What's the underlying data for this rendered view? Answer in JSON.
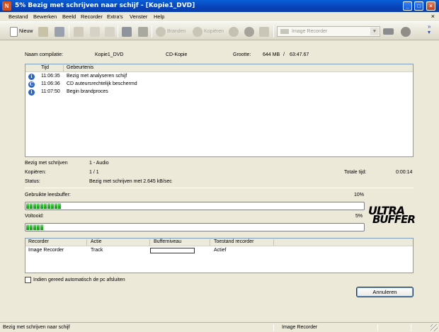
{
  "window": {
    "title": "5% Bezig met schrijven naar schijf - [Kopie1_DVD]",
    "buttons": [
      "minimize",
      "maximize",
      "close"
    ]
  },
  "menu": [
    "Bestand",
    "Bewerken",
    "Beeld",
    "Recorder",
    "Extra's",
    "Venster",
    "Help"
  ],
  "toolbar": {
    "new_label": "Nieuw",
    "branden_label": "Branden",
    "kopieren_label": "Kopiëren",
    "recorder_select": "Image Recorder"
  },
  "summary": {
    "name_label": "Naam compilatie:",
    "name_value": "Kopie1_DVD",
    "type_value": "CD-Kopie",
    "size_label": "Grootte:",
    "size_value": "644 MB",
    "size_sep": "/",
    "duration_value": "63:47.67"
  },
  "log": {
    "columns": [
      "Tijd",
      "Gebeurtenis"
    ],
    "rows": [
      {
        "icon": "info-icon",
        "time": "11:06:35",
        "message": "Bezig met analyseren schijf"
      },
      {
        "icon": "copyright-icon",
        "time": "11:06:36",
        "message": "CD auteursrechtelijk beschermd"
      },
      {
        "icon": "info-icon",
        "time": "11:07:50",
        "message": "Begin brandproces"
      }
    ]
  },
  "progress_info": {
    "writing_label": "Bezig met schrijven",
    "writing_value": "1 - Audio",
    "copies_label": "Kopiëren:",
    "copies_value": "1 / 1",
    "total_time_label": "Totale tijd:",
    "total_time_value": "0:00:14",
    "status_label": "Status:",
    "status_value": "Bezig met schrijven met 2.645 kB/sec"
  },
  "buffer": {
    "label": "Gebruikte leesbuffer:",
    "percent_text": "10%",
    "fraction": 0.1
  },
  "done": {
    "label": "Voltooid:",
    "percent_text": "5%",
    "fraction": 0.05
  },
  "logo": {
    "line1": "ULTRA",
    "line2": "BUFFER"
  },
  "recorders": {
    "columns": [
      "Recorder",
      "Actie",
      "Bufferniveau",
      "Toestand recorder"
    ],
    "rows": [
      {
        "recorder": "Image Recorder",
        "action": "Track",
        "buffer_fraction": 0,
        "state": "Actief"
      }
    ]
  },
  "shutdown_checkbox": {
    "label": "Indien gereed automatisch de pc afsluiten",
    "checked": false
  },
  "cancel_button": "Annuleren",
  "statusbar": {
    "left": "Bezig met schrijven naar schijf",
    "right": "Image Recorder"
  }
}
